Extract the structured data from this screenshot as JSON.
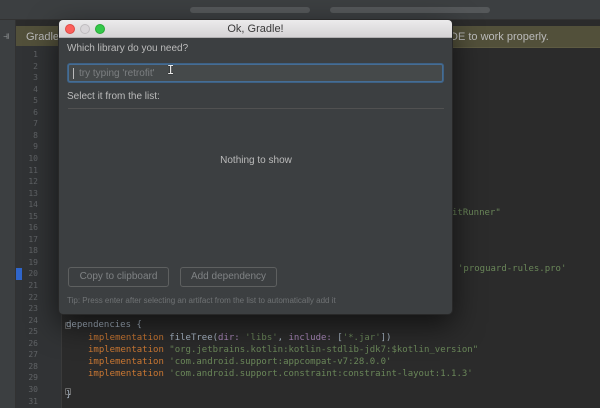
{
  "dialog": {
    "title": "Ok, Gradle!",
    "question_label": "Which library do you need?",
    "search": {
      "placeholder": "try typing 'retrofit'",
      "value": ""
    },
    "list_label": "Select it from the list:",
    "empty_message": "Nothing to show",
    "copy_button": "Copy to clipboard",
    "add_button": "Add dependency",
    "tip": "Tip: Press enter after selecting an artifact from the list to automatically add it"
  },
  "ide": {
    "banner_left": "Gradle",
    "banner_right": "DE to work properly.",
    "line_numbers": [
      "1",
      "2",
      "3",
      "4",
      "5",
      "6",
      "7",
      "8",
      "9",
      "10",
      "11",
      "12",
      "13",
      "14",
      "15",
      "16",
      "17",
      "18",
      "19",
      "20",
      "21",
      "22",
      "23",
      "24",
      "25",
      "26",
      "27",
      "28",
      "29",
      "30",
      "31"
    ],
    "code_fragment_runner": "itRunner\"",
    "code_fragment_proguard": "'proguard-rules.pro'",
    "dependencies": {
      "header": "dependencies {",
      "lines": [
        {
          "kw": "implementation",
          "text_a": " fileTree(",
          "param_a": "dir: ",
          "str_a": "'libs'",
          "text_b": ", ",
          "param_b": "include: ",
          "text_c": "[",
          "str_b": "'*.jar'",
          "text_d": "])"
        },
        {
          "kw": "implementation",
          "str": "\"org.jetbrains.kotlin:kotlin-stdlib-jdk7:$kotlin_version\""
        },
        {
          "kw": "implementation",
          "str": "'com.android.support:appcompat-v7:28.0.0'"
        },
        {
          "kw": "implementation",
          "str": "'com.android.support.constraint:constraint-layout:1.1.3'"
        }
      ],
      "footer": "}"
    }
  }
}
